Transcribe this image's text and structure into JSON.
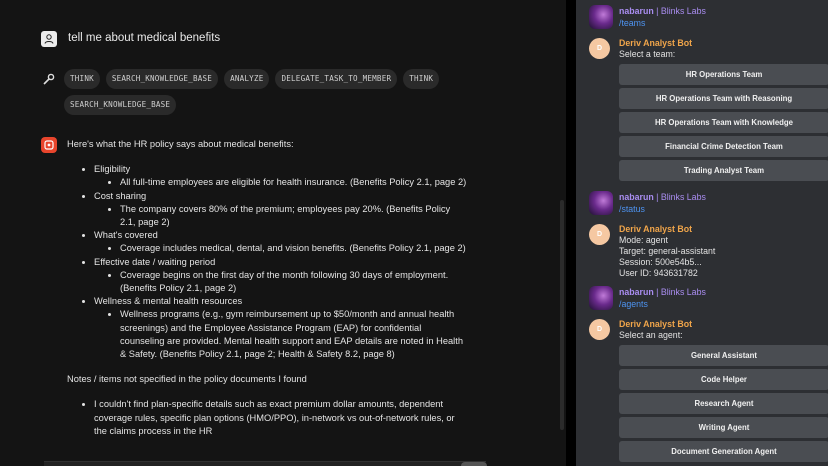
{
  "chat": {
    "user_message": "tell me about medical benefits",
    "tool_chips": [
      "THINK",
      "SEARCH_KNOWLEDGE_BASE",
      "ANALYZE",
      "DELEGATE_TASK_TO_MEMBER",
      "THINK",
      "SEARCH_KNOWLEDGE_BASE"
    ],
    "intro": "Here's what the HR policy says about medical benefits:",
    "sections": [
      {
        "title": "Eligibility",
        "details": [
          "All full-time employees are eligible for health insurance. (Benefits Policy 2.1, page 2)"
        ]
      },
      {
        "title": "Cost sharing",
        "details": [
          "The company covers 80% of the premium; employees pay 20%. (Benefits Policy 2.1, page 2)"
        ]
      },
      {
        "title": "What's covered",
        "details": [
          "Coverage includes medical, dental, and vision benefits. (Benefits Policy 2.1, page 2)"
        ]
      },
      {
        "title": "Effective date / waiting period",
        "details": [
          "Coverage begins on the first day of the month following 30 days of employment. (Benefits Policy 2.1, page 2)"
        ]
      },
      {
        "title": "Wellness & mental health resources",
        "details": [
          "Wellness programs (e.g., gym reimbursement up to $50/month and annual health screenings) and the Employee Assistance Program (EAP) for confidential counseling are provided. Mental health support and EAP details are noted in Health & Safety. (Benefits Policy 2.1, page 2; Health & Safety 8.2, page 8)"
        ]
      }
    ],
    "notes_heading": "Notes / items not specified in the policy documents I found",
    "notes": [
      "I couldn't find plan-specific details such as exact premium dollar amounts, dependent coverage rules, specific plan options (HMO/PPO), in-network vs out-of-network rules, or the claims process in the HR"
    ]
  },
  "side": {
    "user_name": "nabarun",
    "user_org": " | Blinks Labs",
    "bot_name": "Deriv Analyst Bot",
    "bot_initial": "D",
    "cmd_teams": "/teams",
    "select_team": "Select a team:",
    "teams": [
      "HR Operations Team",
      "HR Operations Team with Reasoning",
      "HR Operations Team with Knowledge",
      "Financial Crime Detection Team",
      "Trading Analyst Team"
    ],
    "cmd_status": "/status",
    "status_lines": [
      "Mode: agent",
      "Target: general-assistant",
      "Session: 500e54b5...",
      "User ID: 943631782"
    ],
    "cmd_agents": "/agents",
    "select_agent": "Select an agent:",
    "agents": [
      "General Assistant",
      "Code Helper",
      "Research Agent",
      "Writing Agent",
      "Document Generation Agent"
    ]
  },
  "colors": {
    "username": "#a98df0",
    "command": "#4d93f0",
    "botname": "#f0a54a",
    "bot_accent": "#e8452c"
  }
}
